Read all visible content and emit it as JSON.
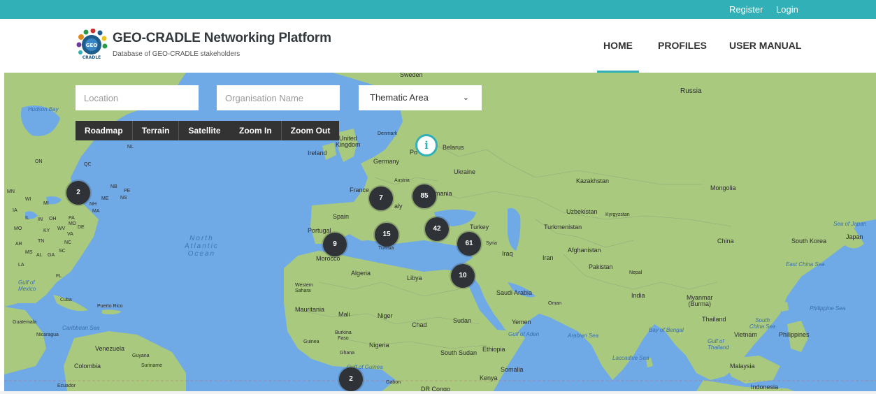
{
  "topbar": {
    "register": "Register",
    "login": "Login",
    "color": "#31b0b7"
  },
  "brand": {
    "title": "GEO-CRADLE Networking Platform",
    "subtitle": "Database of GEO-CRADLE stakeholders",
    "logo_icon": "geo-cradle-logo"
  },
  "nav": {
    "home": "HOME",
    "profiles": "PROFILES",
    "user_manual": "USER MANUAL",
    "active": "HOME"
  },
  "filters": {
    "location_placeholder": "Location",
    "organisation_placeholder": "Organisation Name",
    "thematic_area": "Thematic Area",
    "thematic_icon": "chevron-down-icon"
  },
  "map_controls": {
    "roadmap": "Roadmap",
    "terrain": "Terrain",
    "satellite": "Satellite",
    "zoom_in": "Zoom In",
    "zoom_out": "Zoom Out"
  },
  "clusters": [
    "2",
    "7",
    "85",
    "15",
    "42",
    "9",
    "61",
    "10",
    "2"
  ],
  "info_marker": {
    "glyph": "i",
    "icon": "info-marker-icon"
  },
  "map_labels": {
    "russia": "Russia",
    "belarus": "Belarus",
    "ukraine": "Ukraine",
    "kazakhstan": "Kazakhstan",
    "mongolia": "Mongolia",
    "united_kingdom": "United\nKingdom",
    "ireland": "Ireland",
    "denmark": "Denmark",
    "germany": "Germany",
    "poland": "Po",
    "austria": "Austria",
    "france": "France",
    "spain": "Spain",
    "portugal": "Portugal",
    "italy": "aly",
    "romania": "mania",
    "turkey": "Turkey",
    "uzbekistan": "Uzbekistan",
    "kyrgyzstan": "Kyrgyzstan",
    "turkmenistan": "Turkmenistan",
    "china": "China",
    "south_korea": "South Korea",
    "japan": "Japan",
    "syria": "Syria",
    "afghanistan": "Afghanistan",
    "iraq": "Iraq",
    "iran": "Iran",
    "pakistan": "Pakistan",
    "nepal": "Nepal",
    "india": "India",
    "myanmar": "Myanmar\n(Burma)",
    "thailand": "Thailand",
    "vietnam": "Vietnam",
    "philippines": "Philippines",
    "malaysia": "Malaysia",
    "indonesia": "Indonesia",
    "morocco": "Morocco",
    "tunisia": "Tunisia",
    "algeria": "Algeria",
    "libya": "Libya",
    "western_sahara": "Western\nSahara",
    "mauritania": "Mauritania",
    "mali": "Mali",
    "niger": "Niger",
    "chad": "Chad",
    "sudan": "Sudan",
    "saudi_arabia": "Saudi Arabia",
    "oman": "Oman",
    "yemen": "Yemen",
    "nigeria": "Nigeria",
    "burkina_faso": "Burkina\nFaso",
    "ghana": "Ghana",
    "guinea": "Guinea",
    "ethiopia": "Ethiopia",
    "south_sudan": "South Sudan",
    "somalia": "Somalia",
    "kenya": "Kenya",
    "gabon": "Gabon",
    "dr_congo": "DR Congo",
    "venezuela": "Venezuela",
    "colombia": "Colombia",
    "guyana": "Guyana",
    "suriname": "Suriname",
    "ecuador": "Ecuador",
    "cuba": "Cuba",
    "puerto_rico": "Puerto Rico",
    "guatemala": "Guatemala",
    "nicaragua": "Nicaragua",
    "sweden": "Sweden",
    "nl": "NL",
    "on": "ON",
    "qc": "QC",
    "mn": "MN",
    "wi": "WI",
    "mi": "MI",
    "nb": "NB",
    "pe": "PE",
    "ns": "NS",
    "me": "ME",
    "nh": "NH",
    "ma": "MA",
    "ia": "IA",
    "il": "IL",
    "in": "IN",
    "oh": "OH",
    "pa": "PA",
    "md": "MD",
    "de": "DE",
    "mo": "MO",
    "ky": "KY",
    "wv": "WV",
    "va": "VA",
    "ar": "AR",
    "tn": "TN",
    "nc": "NC",
    "ms": "MS",
    "al": "AL",
    "ga": "GA",
    "sc": "SC",
    "la": "LA",
    "fl": "FL"
  },
  "sea_labels": {
    "hudson_bay": "Hudson Bay",
    "gulf_of_mexico": "Gulf of\nMexico",
    "caribbean_sea": "Caribbean Sea",
    "gulf_of_guinea": "Gulf of Guinea",
    "gulf_of_aden": "Gulf of Aden",
    "arabian_sea": "Arabian Sea",
    "bay_of_bengal": "Bay of Bengal",
    "laccadive_sea": "Laccadive Sea",
    "gulf_of_thailand": "Gulf of\nThailand",
    "south_china_sea": "South\nChina Sea",
    "philippine_sea": "Philippine Sea",
    "east_china_sea": "East China Sea",
    "sea_of_japan": "Sea of Japan"
  },
  "ocean_label": "North\nAtlantic\nOcean",
  "colors": {
    "water": "#6fa9e6",
    "land": "#a9c97f",
    "cluster": "#2f3236",
    "accent": "#31b0b7"
  }
}
